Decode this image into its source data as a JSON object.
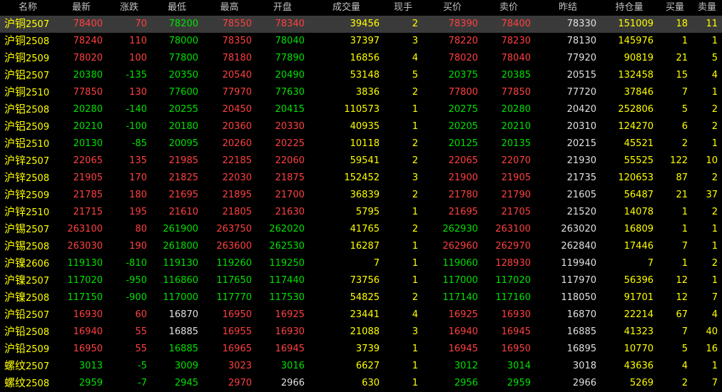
{
  "colors": {
    "up": "#ff4040",
    "down": "#00e000",
    "flat": "#e0e0e0",
    "volume": "#ffff00",
    "header": "#c0c0c0"
  },
  "columns": [
    "名称",
    "最新",
    "涨跌",
    "最低",
    "最高",
    "开盘",
    "成交量",
    "现手",
    "买价",
    "卖价",
    "昨结",
    "持仓量",
    "买量",
    "卖量"
  ],
  "rows": [
    {
      "name": "沪铜",
      "code": "2507",
      "last": "78400",
      "chg": "70",
      "low": "78200",
      "high": "78550",
      "open": "78340",
      "vol": "39456",
      "hand": "2",
      "bid": "78390",
      "ask": "78400",
      "pre": "78330",
      "oi": "151009",
      "bidq": "18",
      "askq": "11",
      "last_c": "red",
      "chg_c": "red",
      "low_c": "green",
      "high_c": "red",
      "open_c": "red",
      "bid_c": "red",
      "ask_c": "red"
    },
    {
      "name": "沪铜",
      "code": "2508",
      "last": "78240",
      "chg": "110",
      "low": "78000",
      "high": "78350",
      "open": "78040",
      "vol": "37397",
      "hand": "3",
      "bid": "78220",
      "ask": "78230",
      "pre": "78130",
      "oi": "145976",
      "bidq": "1",
      "askq": "1",
      "last_c": "red",
      "chg_c": "red",
      "low_c": "green",
      "high_c": "red",
      "open_c": "green",
      "bid_c": "red",
      "ask_c": "red"
    },
    {
      "name": "沪铜",
      "code": "2509",
      "last": "78020",
      "chg": "100",
      "low": "77800",
      "high": "78180",
      "open": "77890",
      "vol": "16856",
      "hand": "4",
      "bid": "78020",
      "ask": "78040",
      "pre": "77920",
      "oi": "90819",
      "bidq": "21",
      "askq": "5",
      "last_c": "red",
      "chg_c": "red",
      "low_c": "green",
      "high_c": "red",
      "open_c": "green",
      "bid_c": "red",
      "ask_c": "red"
    },
    {
      "name": "沪铝",
      "code": "2507",
      "last": "20380",
      "chg": "-135",
      "low": "20350",
      "high": "20540",
      "open": "20490",
      "vol": "53148",
      "hand": "5",
      "bid": "20375",
      "ask": "20385",
      "pre": "20515",
      "oi": "132458",
      "bidq": "15",
      "askq": "4",
      "last_c": "green",
      "chg_c": "green",
      "low_c": "green",
      "high_c": "red",
      "open_c": "green",
      "bid_c": "green",
      "ask_c": "green"
    },
    {
      "name": "沪铜",
      "code": "2510",
      "last": "77850",
      "chg": "130",
      "low": "77600",
      "high": "77970",
      "open": "77630",
      "vol": "3836",
      "hand": "2",
      "bid": "77800",
      "ask": "77850",
      "pre": "77720",
      "oi": "37846",
      "bidq": "7",
      "askq": "1",
      "last_c": "red",
      "chg_c": "red",
      "low_c": "green",
      "high_c": "red",
      "open_c": "green",
      "bid_c": "red",
      "ask_c": "red"
    },
    {
      "name": "沪铝",
      "code": "2508",
      "last": "20280",
      "chg": "-140",
      "low": "20255",
      "high": "20450",
      "open": "20415",
      "vol": "110573",
      "hand": "1",
      "bid": "20275",
      "ask": "20280",
      "pre": "20420",
      "oi": "252806",
      "bidq": "5",
      "askq": "2",
      "last_c": "green",
      "chg_c": "green",
      "low_c": "green",
      "high_c": "red",
      "open_c": "green",
      "bid_c": "green",
      "ask_c": "green"
    },
    {
      "name": "沪铝",
      "code": "2509",
      "last": "20210",
      "chg": "-100",
      "low": "20180",
      "high": "20360",
      "open": "20330",
      "vol": "40935",
      "hand": "1",
      "bid": "20205",
      "ask": "20210",
      "pre": "20310",
      "oi": "124270",
      "bidq": "6",
      "askq": "2",
      "last_c": "green",
      "chg_c": "green",
      "low_c": "green",
      "high_c": "red",
      "open_c": "red",
      "bid_c": "green",
      "ask_c": "green"
    },
    {
      "name": "沪铝",
      "code": "2510",
      "last": "20130",
      "chg": "-85",
      "low": "20095",
      "high": "20260",
      "open": "20225",
      "vol": "10118",
      "hand": "2",
      "bid": "20125",
      "ask": "20135",
      "pre": "20215",
      "oi": "45521",
      "bidq": "2",
      "askq": "1",
      "last_c": "green",
      "chg_c": "green",
      "low_c": "green",
      "high_c": "red",
      "open_c": "red",
      "bid_c": "green",
      "ask_c": "green"
    },
    {
      "name": "沪锌",
      "code": "2507",
      "last": "22065",
      "chg": "135",
      "low": "21985",
      "high": "22185",
      "open": "22060",
      "vol": "59541",
      "hand": "2",
      "bid": "22065",
      "ask": "22070",
      "pre": "21930",
      "oi": "55525",
      "bidq": "122",
      "askq": "10",
      "last_c": "red",
      "chg_c": "red",
      "low_c": "red",
      "high_c": "red",
      "open_c": "red",
      "bid_c": "red",
      "ask_c": "red"
    },
    {
      "name": "沪锌",
      "code": "2508",
      "last": "21905",
      "chg": "170",
      "low": "21825",
      "high": "22030",
      "open": "21875",
      "vol": "152452",
      "hand": "3",
      "bid": "21900",
      "ask": "21905",
      "pre": "21735",
      "oi": "120653",
      "bidq": "87",
      "askq": "2",
      "last_c": "red",
      "chg_c": "red",
      "low_c": "red",
      "high_c": "red",
      "open_c": "red",
      "bid_c": "red",
      "ask_c": "red"
    },
    {
      "name": "沪锌",
      "code": "2509",
      "last": "21785",
      "chg": "180",
      "low": "21695",
      "high": "21895",
      "open": "21700",
      "vol": "36839",
      "hand": "2",
      "bid": "21780",
      "ask": "21790",
      "pre": "21605",
      "oi": "56487",
      "bidq": "21",
      "askq": "37",
      "last_c": "red",
      "chg_c": "red",
      "low_c": "red",
      "high_c": "red",
      "open_c": "red",
      "bid_c": "red",
      "ask_c": "red"
    },
    {
      "name": "沪锌",
      "code": "2510",
      "last": "21715",
      "chg": "195",
      "low": "21610",
      "high": "21805",
      "open": "21630",
      "vol": "5795",
      "hand": "1",
      "bid": "21695",
      "ask": "21705",
      "pre": "21520",
      "oi": "14078",
      "bidq": "1",
      "askq": "2",
      "last_c": "red",
      "chg_c": "red",
      "low_c": "red",
      "high_c": "red",
      "open_c": "red",
      "bid_c": "red",
      "ask_c": "red"
    },
    {
      "name": "沪锡",
      "code": "2507",
      "last": "263100",
      "chg": "80",
      "low": "261900",
      "high": "263750",
      "open": "262020",
      "vol": "41765",
      "hand": "2",
      "bid": "262930",
      "ask": "263100",
      "pre": "263020",
      "oi": "16809",
      "bidq": "1",
      "askq": "1",
      "last_c": "red",
      "chg_c": "red",
      "low_c": "green",
      "high_c": "red",
      "open_c": "green",
      "bid_c": "green",
      "ask_c": "red"
    },
    {
      "name": "沪锡",
      "code": "2508",
      "last": "263030",
      "chg": "190",
      "low": "261800",
      "high": "263600",
      "open": "262530",
      "vol": "16287",
      "hand": "1",
      "bid": "262960",
      "ask": "262970",
      "pre": "262840",
      "oi": "17446",
      "bidq": "7",
      "askq": "1",
      "last_c": "red",
      "chg_c": "red",
      "low_c": "green",
      "high_c": "red",
      "open_c": "green",
      "bid_c": "red",
      "ask_c": "red"
    },
    {
      "name": "沪镍",
      "code": "2606",
      "last": "119130",
      "chg": "-810",
      "low": "119130",
      "high": "119260",
      "open": "119250",
      "vol": "7",
      "hand": "1",
      "bid": "119060",
      "ask": "128930",
      "pre": "119940",
      "oi": "7",
      "bidq": "1",
      "askq": "2",
      "last_c": "green",
      "chg_c": "green",
      "low_c": "green",
      "high_c": "green",
      "open_c": "green",
      "bid_c": "green",
      "ask_c": "red"
    },
    {
      "name": "沪镍",
      "code": "2507",
      "last": "117020",
      "chg": "-950",
      "low": "116860",
      "high": "117650",
      "open": "117440",
      "vol": "73756",
      "hand": "1",
      "bid": "117000",
      "ask": "117020",
      "pre": "117970",
      "oi": "56396",
      "bidq": "12",
      "askq": "1",
      "last_c": "green",
      "chg_c": "green",
      "low_c": "green",
      "high_c": "green",
      "open_c": "green",
      "bid_c": "green",
      "ask_c": "green"
    },
    {
      "name": "沪镍",
      "code": "2508",
      "last": "117150",
      "chg": "-900",
      "low": "117000",
      "high": "117770",
      "open": "117530",
      "vol": "54825",
      "hand": "2",
      "bid": "117140",
      "ask": "117160",
      "pre": "118050",
      "oi": "91701",
      "bidq": "12",
      "askq": "7",
      "last_c": "green",
      "chg_c": "green",
      "low_c": "green",
      "high_c": "green",
      "open_c": "green",
      "bid_c": "green",
      "ask_c": "green"
    },
    {
      "name": "沪铅",
      "code": "2507",
      "last": "16930",
      "chg": "60",
      "low": "16870",
      "high": "16950",
      "open": "16925",
      "vol": "23441",
      "hand": "4",
      "bid": "16925",
      "ask": "16930",
      "pre": "16870",
      "oi": "22214",
      "bidq": "67",
      "askq": "4",
      "last_c": "red",
      "chg_c": "red",
      "low_c": "white",
      "high_c": "red",
      "open_c": "red",
      "bid_c": "red",
      "ask_c": "red"
    },
    {
      "name": "沪铅",
      "code": "2508",
      "last": "16940",
      "chg": "55",
      "low": "16885",
      "high": "16955",
      "open": "16930",
      "vol": "21088",
      "hand": "3",
      "bid": "16940",
      "ask": "16945",
      "pre": "16885",
      "oi": "41323",
      "bidq": "7",
      "askq": "40",
      "last_c": "red",
      "chg_c": "red",
      "low_c": "white",
      "high_c": "red",
      "open_c": "red",
      "bid_c": "red",
      "ask_c": "red"
    },
    {
      "name": "沪铅",
      "code": "2509",
      "last": "16950",
      "chg": "55",
      "low": "16885",
      "high": "16965",
      "open": "16945",
      "vol": "3739",
      "hand": "1",
      "bid": "16945",
      "ask": "16950",
      "pre": "16895",
      "oi": "10770",
      "bidq": "5",
      "askq": "16",
      "last_c": "red",
      "chg_c": "red",
      "low_c": "green",
      "high_c": "red",
      "open_c": "red",
      "bid_c": "red",
      "ask_c": "red"
    },
    {
      "name": "螺纹",
      "code": "2507",
      "last": "3013",
      "chg": "-5",
      "low": "3009",
      "high": "3023",
      "open": "3016",
      "vol": "6627",
      "hand": "1",
      "bid": "3012",
      "ask": "3014",
      "pre": "3018",
      "oi": "43636",
      "bidq": "4",
      "askq": "1",
      "last_c": "green",
      "chg_c": "green",
      "low_c": "green",
      "high_c": "red",
      "open_c": "green",
      "bid_c": "green",
      "ask_c": "green"
    },
    {
      "name": "螺纹",
      "code": "2508",
      "last": "2959",
      "chg": "-7",
      "low": "2945",
      "high": "2970",
      "open": "2966",
      "vol": "630",
      "hand": "1",
      "bid": "2956",
      "ask": "2959",
      "pre": "2966",
      "oi": "5269",
      "bidq": "2",
      "askq": "7",
      "last_c": "green",
      "chg_c": "green",
      "low_c": "green",
      "high_c": "red",
      "open_c": "white",
      "bid_c": "green",
      "ask_c": "green"
    }
  ]
}
